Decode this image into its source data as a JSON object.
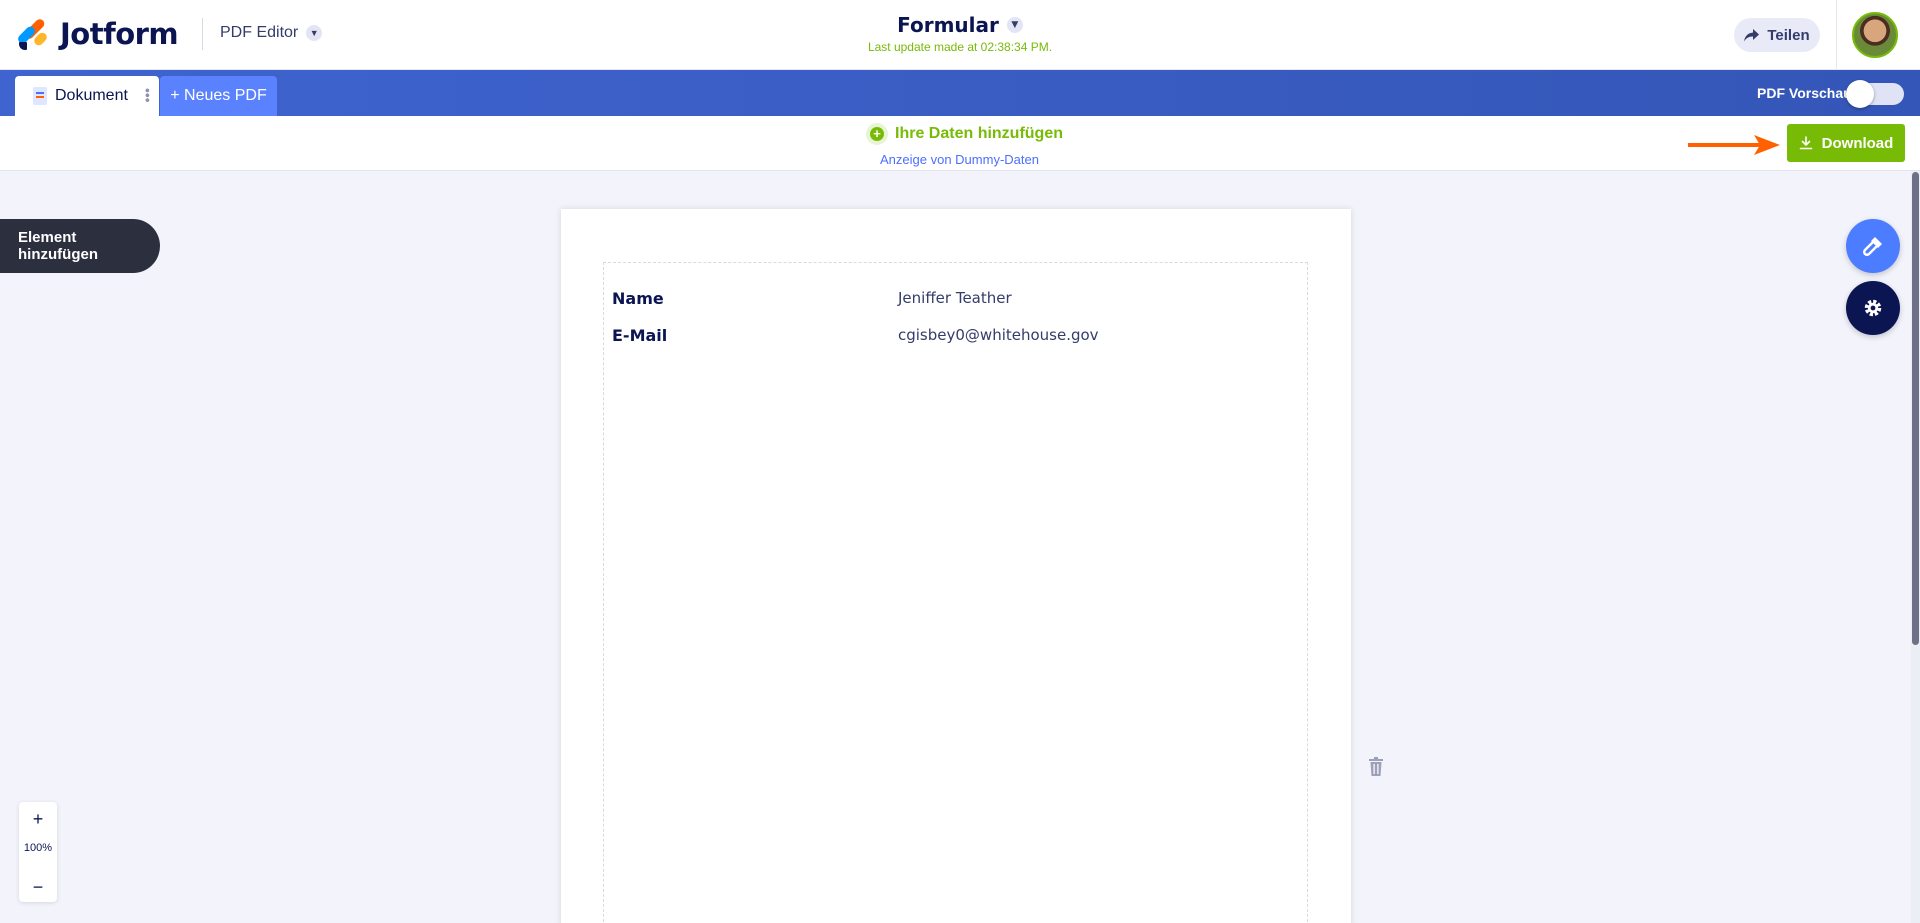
{
  "header": {
    "logo_text": "Jotform",
    "app_name": "PDF Editor",
    "form_title": "Formular",
    "last_update": "Last update made at 02:38:34 PM.",
    "share_label": "Teilen"
  },
  "tabs": {
    "document_label": "Dokument",
    "new_pdf_label": "+ Neues PDF",
    "pdf_preview_label": "PDF Vorschau",
    "pdf_preview_enabled": false
  },
  "databar": {
    "add_data_label": "Ihre Daten hinzufügen",
    "dummy_data_label": "Anzeige von Dummy-Daten",
    "download_label": "Download"
  },
  "sidebar": {
    "add_element_label": "Element hinzufügen"
  },
  "document": {
    "fields": [
      {
        "label": "Name",
        "value": "Jeniffer Teather"
      },
      {
        "label": "E-Mail",
        "value": "cgisbey0@whitehouse.gov"
      }
    ]
  },
  "zoom": {
    "in_label": "+",
    "level": "100%",
    "out_label": "−"
  },
  "colors": {
    "brand_navy": "#0a1551",
    "accent_green": "#78bb07",
    "tab_blue": "#3f64cf",
    "arrow_orange": "#ff6100",
    "paint_blue": "#4c7cff"
  },
  "icons": {
    "share": "share-arrow-icon",
    "download": "download-icon",
    "paint": "paint-roller-icon",
    "settings": "gear-icon",
    "trash": "trash-icon"
  }
}
